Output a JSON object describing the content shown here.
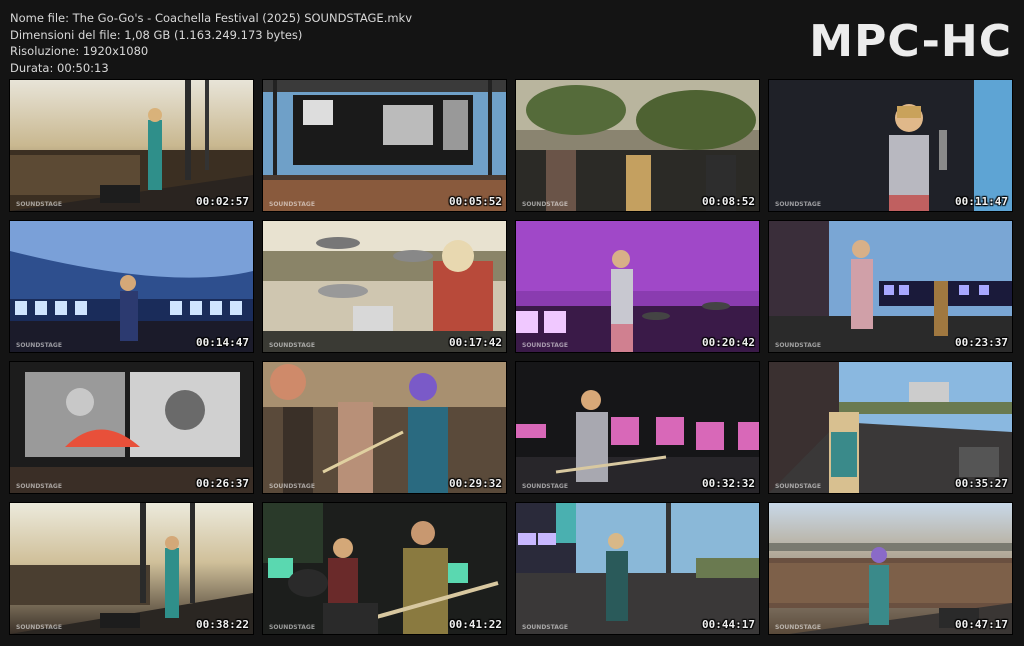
{
  "file_info": {
    "name": "Nome file: The Go-Go's - Coachella Festival (2025) SOUNDSTAGE.mkv",
    "size": "Dimensioni del file: 1,08 GB (1.163.249.173 bytes)",
    "resolution": "Risoluzione: 1920x1080",
    "duration": "Durata: 00:50:13"
  },
  "logo": "MPC-HC",
  "thumbnails": [
    {
      "timestamp": "00:02:57",
      "scene": "stage-sunset-wide"
    },
    {
      "timestamp": "00:05:52",
      "scene": "main-stage-screens-crowd"
    },
    {
      "timestamp": "00:08:52",
      "scene": "band-backlit-palms"
    },
    {
      "timestamp": "00:11:47",
      "scene": "singer-sequin-closeup"
    },
    {
      "timestamp": "00:14:47",
      "scene": "bassist-blue-stage"
    },
    {
      "timestamp": "00:17:42",
      "scene": "drummer-kit"
    },
    {
      "timestamp": "00:20:42",
      "scene": "singer-purple-stage"
    },
    {
      "timestamp": "00:23:37",
      "scene": "singer-guitarist-sky"
    },
    {
      "timestamp": "00:26:37",
      "scene": "screen-photos-fan"
    },
    {
      "timestamp": "00:29:32",
      "scene": "guitarists-closeup"
    },
    {
      "timestamp": "00:32:32",
      "scene": "guitarist-dark-lights"
    },
    {
      "timestamp": "00:35:27",
      "scene": "bassist-on-stage-palms"
    },
    {
      "timestamp": "00:38:22",
      "scene": "stage-sunset-crowd"
    },
    {
      "timestamp": "00:41:22",
      "scene": "bassist-drummer-green"
    },
    {
      "timestamp": "00:44:17",
      "scene": "guitarist-stage-side"
    },
    {
      "timestamp": "00:47:17",
      "scene": "singer-crowd-wide"
    }
  ],
  "watermark": "SOUNDSTAGE"
}
